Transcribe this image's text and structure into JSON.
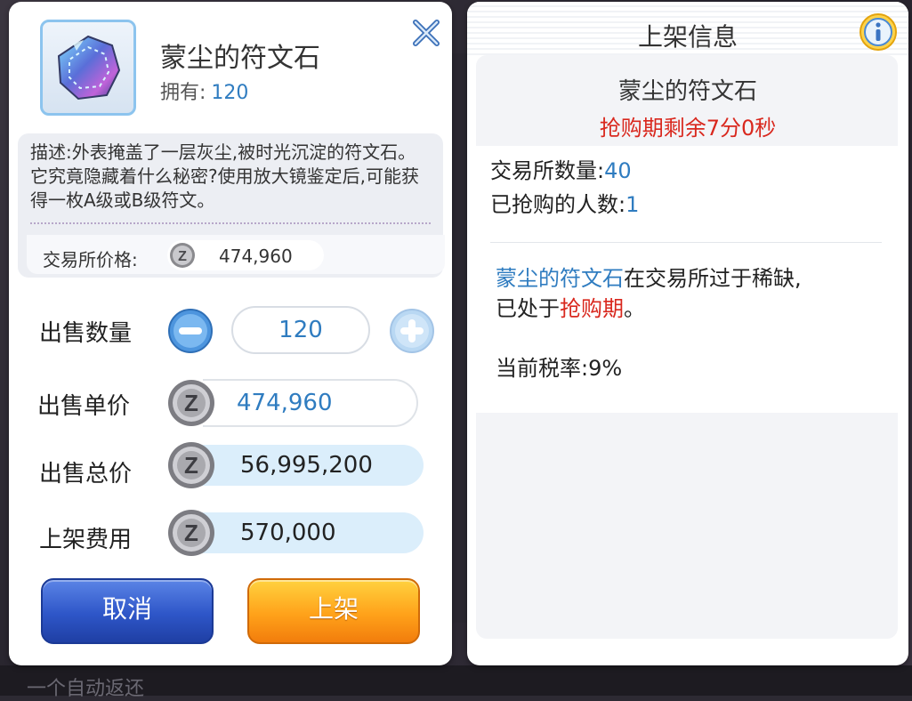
{
  "sell": {
    "item_name": "蒙尘的符文石",
    "owned_label": "拥有:",
    "owned_value": "120",
    "description": "描述:外表掩盖了一层灰尘,被时光沉淀的符文石。它究竟隐藏着什么秘密?使用放大镜鉴定后,可能获得一枚A级或B级符文。",
    "exchange_price_label": "交易所价格:",
    "exchange_price_value": "474,960",
    "quantity_label": "出售数量",
    "quantity_value": "120",
    "unit_price_label": "出售单价",
    "unit_price_value": "474,960",
    "total_price_label": "出售总价",
    "total_price_value": "56,995,200",
    "listing_fee_label": "上架费用",
    "listing_fee_value": "570,000",
    "cancel_label": "取消",
    "list_label": "上架"
  },
  "info": {
    "title": "上架信息",
    "item_name": "蒙尘的符文石",
    "timer_text": "抢购期剩余7分0秒",
    "exchange_count_label": "交易所数量:",
    "exchange_count_value": "40",
    "buyers_label": "已抢购的人数:",
    "buyers_value": "1",
    "msg_item": "蒙尘的符文石",
    "msg_part1": "在交易所过于稀缺,",
    "msg_part2": "已处于",
    "msg_period": "抢购期",
    "msg_end": "。",
    "tax_label": "当前税率:",
    "tax_value": "9%"
  },
  "background": {
    "bottom_text": "一个自动返还"
  },
  "colors": {
    "accent_blue": "#2f7cc0",
    "alert_red": "#d9281e",
    "cancel_button": "#2e56c8",
    "list_button": "#ffa21a"
  },
  "icons": [
    "rune-stone-icon",
    "close-icon",
    "minus-icon",
    "plus-icon",
    "zeny-coin-icon",
    "info-icon"
  ]
}
